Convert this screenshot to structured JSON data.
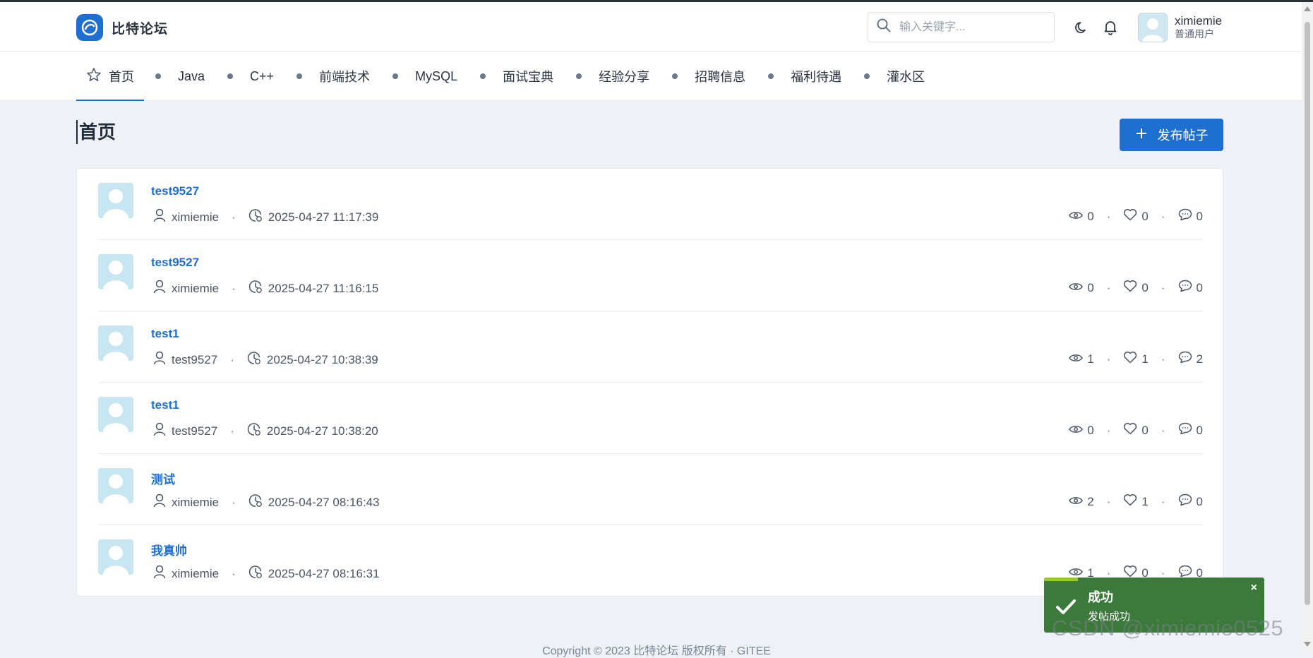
{
  "header": {
    "brand_name": "比特论坛",
    "search_placeholder": "输入关键字...",
    "user": {
      "name": "ximiemie",
      "role": "普通用户"
    }
  },
  "nav": {
    "items": [
      {
        "label": "首页",
        "icon": "star-icon",
        "active": true
      },
      {
        "label": "Java"
      },
      {
        "label": "C++"
      },
      {
        "label": "前端技术"
      },
      {
        "label": "MySQL"
      },
      {
        "label": "面试宝典"
      },
      {
        "label": "经验分享"
      },
      {
        "label": "招聘信息"
      },
      {
        "label": "福利待遇"
      },
      {
        "label": "灌水区"
      }
    ]
  },
  "page": {
    "title": "首页",
    "publish_label": "发布帖子"
  },
  "posts": [
    {
      "title": "test9527",
      "author": "ximiemie",
      "time": "2025-04-27 11:17:39",
      "views": "0",
      "likes": "0",
      "comments": "0"
    },
    {
      "title": "test9527",
      "author": "ximiemie",
      "time": "2025-04-27 11:16:15",
      "views": "0",
      "likes": "0",
      "comments": "0"
    },
    {
      "title": "test1",
      "author": "test9527",
      "time": "2025-04-27 10:38:39",
      "views": "1",
      "likes": "1",
      "comments": "2"
    },
    {
      "title": "test1",
      "author": "test9527",
      "time": "2025-04-27 10:38:20",
      "views": "0",
      "likes": "0",
      "comments": "0"
    },
    {
      "title": "测试",
      "author": "ximiemie",
      "time": "2025-04-27 08:16:43",
      "views": "2",
      "likes": "1",
      "comments": "0"
    },
    {
      "title": "我真帅",
      "author": "ximiemie",
      "time": "2025-04-27 08:16:31",
      "views": "1",
      "likes": "0",
      "comments": "0"
    }
  ],
  "footer": {
    "text": "Copyright © 2023 比特论坛 版权所有 · GITEE"
  },
  "toast": {
    "title": "成功",
    "message": "发帖成功",
    "close": "×"
  },
  "watermark": "CSDN @ximiemie0525",
  "colors": {
    "accent": "#1f6fd0",
    "toast": "#3b7a3b",
    "toast_bar": "#9ac92f"
  }
}
